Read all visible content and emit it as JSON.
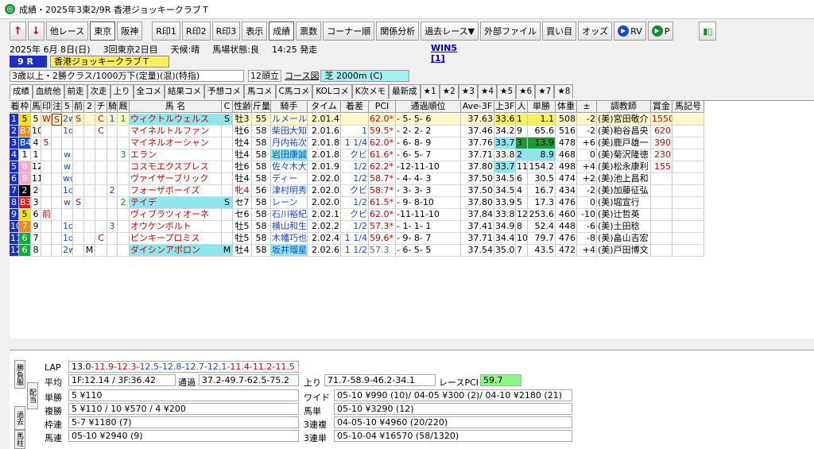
{
  "window": {
    "title": "成績・2025年3東2/9R 香港ジョッキークラブＴ"
  },
  "toolbar": {
    "buttons": [
      "他レース",
      "東京",
      "阪神",
      "R印1",
      "R印2",
      "R印3",
      "表示",
      "成績",
      "票数",
      "コーナー順",
      "関係分析",
      "過去レース▼",
      "外部ファイル",
      "買い目",
      "オッズ",
      "RV",
      "P"
    ]
  },
  "race": {
    "date": "2025年 6月 8日(日)",
    "meet": "3回東京2日目",
    "weather_label": "天候:",
    "weather": "晴",
    "track_label": "馬場状態:",
    "track": "良",
    "start": "14:25 発走",
    "win5": "WIN5 [1]",
    "number": "9 R",
    "name": "香港ジョッキークラブＴ",
    "conditions": "3歳以上・2勝クラス/1000万下(定量)(混)(特指)",
    "heads": "12頭立",
    "course_btn": "コース図",
    "course": "芝 2000m (C)"
  },
  "tabs": [
    "成績",
    "血統他",
    "前走",
    "次走",
    "上り",
    "全コメ",
    "結果コメ",
    "予想コメ",
    "馬コメ",
    "C馬コメ",
    "KOLコメ",
    "K次メモ",
    "最新成",
    "★1",
    "★2",
    "★3",
    "★4",
    "★5",
    "★6",
    "★7",
    "★8"
  ],
  "columns": [
    "着",
    "枠",
    "馬",
    "印",
    "注",
    "5",
    "前",
    "2",
    "チ",
    "騎",
    "厩",
    "馬 名",
    "C",
    "性齢",
    "斤量",
    "騎手",
    "タイム",
    "着差",
    "PCI",
    "通過順位",
    "Ave-3F",
    "上3F",
    "人",
    "単勝",
    "体重",
    "±",
    "調教師",
    "賞金",
    "馬記号"
  ],
  "rows": [
    [
      "1",
      "5",
      "5",
      "W",
      "S",
      "2w",
      "S",
      "",
      "C",
      "1",
      "1",
      "ウィクトルウェルス",
      "S",
      "牡3",
      "55",
      "ルメール",
      "2.01.4",
      "",
      "62.0*",
      "- 5- 5- 6",
      "37.63",
      "33.6",
      "1",
      "1.1",
      "508",
      "-2",
      "(美)宮田敬介",
      "1550",
      ""
    ],
    [
      "2",
      "B7",
      "10",
      "",
      "",
      "1d",
      "",
      "",
      "C",
      "",
      "",
      "マイネルトルファン",
      "",
      "牡6",
      "58",
      "柴田大知",
      "2.01.6",
      "1",
      "59.5*",
      "- 2- 2- 2",
      "37.46",
      "34.2",
      "9",
      "65.6",
      "516",
      "-2",
      "(美)粕谷昌央",
      "620",
      ""
    ],
    [
      "3",
      "B4",
      "4",
      "5",
      "",
      "",
      "",
      "",
      "",
      "",
      "",
      "マイネルオーシャン",
      "",
      "牡4",
      "58",
      "丹内祐次",
      "2.01.8",
      "1 1/4",
      "62.0*",
      "- 6- 8- 9",
      "37.76",
      "33.7",
      "3",
      "13.9",
      "478",
      "+6",
      "(美)鹿戸雄一",
      "390",
      ""
    ],
    [
      "4",
      "1",
      "1",
      "",
      "",
      "w",
      "",
      "",
      "",
      "",
      "3",
      "エラン",
      "",
      "牡4",
      "58",
      "岩田康誠",
      "2.01.8",
      "クビ",
      "61.6*",
      "- 6- 5- 7",
      "37.71",
      "33.8",
      "2",
      "8.9",
      "468",
      "0",
      "(美)菊沢隆徳",
      "230",
      ""
    ],
    [
      "5",
      "8",
      "12",
      "",
      "",
      "w",
      "",
      "",
      "",
      "",
      "",
      "コスモエクスプレス",
      "",
      "牡6",
      "58",
      "佐々木大",
      "2.01.9",
      "1/2",
      "62.2*",
      "-12-11-10",
      "37.80",
      "33.7",
      "11",
      "154.2",
      "498",
      "+4",
      "(美)松永康利",
      "155",
      ""
    ],
    [
      "6",
      "8",
      "11",
      "",
      "",
      "wd",
      "",
      "",
      "",
      "",
      "",
      "ヴァイザーブリック",
      "",
      "牡4",
      "58",
      "ディー",
      "2.02.0",
      "1/2",
      "58.7*",
      "- 4- 4- 3",
      "37.50",
      "34.5",
      "6",
      "30.5",
      "474",
      "+2",
      "(美)池上昌和",
      "",
      ""
    ],
    [
      "7",
      "2",
      "2",
      "",
      "",
      "1d",
      "",
      "",
      "",
      "2",
      "",
      "フォーザボーイズ",
      "",
      "牝4",
      "56",
      "津村明秀",
      "2.02.0",
      "クビ",
      "58.7*",
      "- 3- 3- 3",
      "37.50",
      "34.5",
      "4",
      "16.7",
      "434",
      "-2",
      "(美)加藤征弘",
      "",
      ""
    ],
    [
      "8",
      "B3",
      "3",
      "",
      "",
      "w",
      "S",
      "",
      "",
      "",
      "2",
      "テイデ",
      "S",
      "セ7",
      "58",
      "レーン",
      "2.02.0",
      "1/2",
      "61.5*",
      "- 9- 8-10",
      "37.80",
      "33.9",
      "5",
      "17.3",
      "476",
      "0",
      "(美)堀宣行",
      "",
      ""
    ],
    [
      "9",
      "5",
      "6",
      "前",
      "",
      "",
      "",
      "",
      "",
      "",
      "",
      "ヴィブラツィオーネ",
      "",
      "セ6",
      "58",
      "石川裕紀",
      "2.02.1",
      "クビ",
      "62.0*",
      "-11-11-10",
      "37.84",
      "33.8",
      "12",
      "253.6",
      "460",
      "-10",
      "(美)辻哲英",
      "",
      ""
    ],
    [
      "10",
      "7",
      "9",
      "",
      "",
      "1d",
      "",
      "",
      "",
      "3",
      "",
      "オウケンボルト",
      "",
      "牡5",
      "58",
      "横山和生",
      "2.02.2",
      "1/2",
      "57.3*",
      "- 1- 1- 1",
      "37.41",
      "34.9",
      "8",
      "52.4",
      "448",
      "-6",
      "(美)土田稔",
      "",
      ""
    ],
    [
      "11",
      "6",
      "7",
      "",
      "",
      "1d",
      "",
      "",
      "C",
      "",
      "",
      "ピンキープロミス",
      "",
      "牡5",
      "58",
      "木幡巧也",
      "2.02.4",
      "1 1/4",
      "59.6*",
      "- 9- 8- 7",
      "37.71",
      "34.4",
      "10",
      "79.7",
      "476",
      "-8",
      "(美)畠山吉宏",
      "",
      ""
    ],
    [
      "12",
      "6",
      "8",
      "",
      "",
      "2w",
      "",
      "M",
      "",
      "",
      "",
      "ダイシンアポロン",
      "M",
      "牡4",
      "58",
      "坂井瑠星",
      "2.02.6",
      "1 1/2",
      "57.3",
      "- 6- 5- 5",
      "37.54",
      "35.0",
      "7",
      "43.5",
      "472",
      "+4",
      "(美)戸田博文",
      "",
      ""
    ]
  ],
  "bottom": {
    "vtabs": [
      "勝負服",
      "配当",
      "過去",
      "馬柱"
    ],
    "lap_label": "LAP",
    "laps": [
      "13.0",
      "11.9",
      "12.3",
      "12.5",
      "12.8",
      "12.7",
      "12.1",
      "11.4",
      "11.2",
      "11.5"
    ],
    "avg_label": "平均",
    "avg": "1F:12.14 / 3F:36.42",
    "pass_label": "通過",
    "pass": "37.2-49.7-62.5-75.2",
    "agari_label": "上り",
    "agari": "71.7-58.9-46.2-34.1",
    "rpci_label": "レースPCI",
    "rpci": "59.7",
    "pays": [
      {
        "l": "単勝",
        "v": "5 ¥110"
      },
      {
        "l": "複勝",
        "v": "5 ¥110 / 10 ¥570 / 4 ¥200"
      },
      {
        "l": "枠連",
        "v": "5-7 ¥1180 (7)"
      },
      {
        "l": "馬連",
        "v": "05-10 ¥2940 (9)"
      }
    ],
    "pays2": [
      {
        "l": "ワイド",
        "v": "05-10 ¥990 (10)/ 04-05 ¥300 (2)/ 04-10 ¥2180 (21)"
      },
      {
        "l": "馬単",
        "v": "05-10 ¥3290 (12)"
      },
      {
        "l": "3連複",
        "v": "04-05-10 ¥4960 (20/220)"
      },
      {
        "l": "3連単",
        "v": "05-10-04 ¥16570 (58/1320)"
      }
    ]
  },
  "colors": {
    "waku": [
      "#ffffff",
      "#000000",
      "#e8141b",
      "#1747d6",
      "#f5e21a",
      "#15a83a",
      "#f28a10",
      "#f7a8c8"
    ],
    "cyan": "#8ce8ee",
    "yellow": "#ffef5a",
    "green": "#8ef58a",
    "pink_red": "#d00000"
  }
}
